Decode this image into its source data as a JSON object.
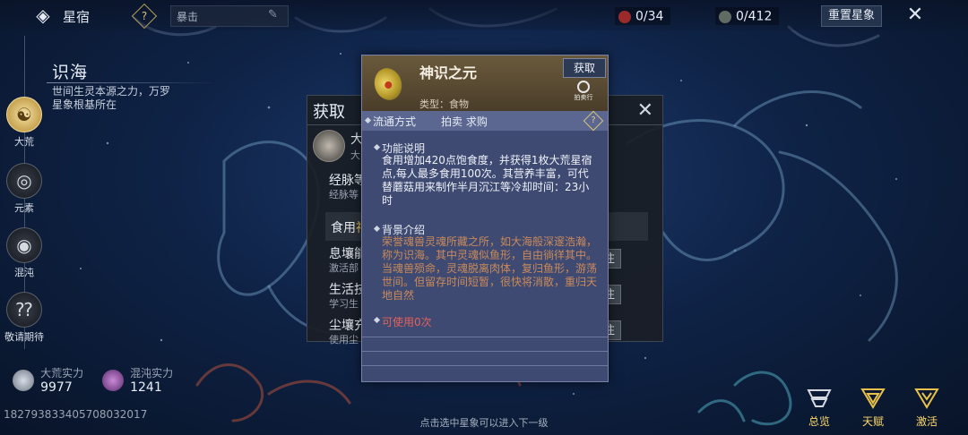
{
  "topbar": {
    "title": "星宿",
    "help_glyph": "?",
    "search_value": "暴击",
    "resource_red": "0/34",
    "resource_gray": "0/412",
    "reset_label": "重置星象",
    "close_glyph": "✕",
    "back_glyph": "◈"
  },
  "left": {
    "section_title": "识海",
    "section_desc": "世间生灵本源之力，万罗星象根基所在",
    "nav": [
      {
        "label": "大荒",
        "icon": "swirl-gold-icon",
        "glyph": "☯"
      },
      {
        "label": "元素",
        "icon": "spiral-icon",
        "glyph": "◎"
      },
      {
        "label": "混沌",
        "icon": "chaos-icon",
        "glyph": "◉"
      },
      {
        "label": "敬请期待",
        "icon": "question-icon",
        "glyph": "⁇"
      }
    ],
    "power": [
      {
        "label": "大荒实力",
        "value": "9977"
      },
      {
        "label": "混沌实力",
        "value": "1241"
      }
    ],
    "uid": "182793833405708032017"
  },
  "bottom": {
    "hint": "点击选中星象可以进入下一级",
    "buttons": [
      {
        "label": "总览",
        "icon": "overview-icon"
      },
      {
        "label": "天赋",
        "icon": "talent-icon"
      },
      {
        "label": "激活",
        "icon": "activate-icon"
      }
    ]
  },
  "dialog": {
    "title": "获取",
    "close_glyph": "✕",
    "item_name_partial": "大",
    "item_sub_partial": "大",
    "rows": [
      {
        "title": "经脉等",
        "sub": "经脉等",
        "go": ""
      },
      {
        "title": "息壤能",
        "sub": "激活部",
        "go": "前往"
      },
      {
        "title": "生活技",
        "sub": "学习生",
        "go": "前往"
      },
      {
        "title": "尘壤充",
        "sub": "使用尘",
        "go": "前往"
      }
    ],
    "food_label": "食用",
    "food_highlight": "神"
  },
  "tooltip": {
    "name": "神识之元",
    "type": "类型：食物",
    "get_label": "获取",
    "auction_label": "拍卖行",
    "flow_key": "流通方式",
    "flow_value": "拍卖  求购",
    "flow_help": "?",
    "func_title": "功能说明",
    "func_body": "食用增加420点饱食度，并获得1枚大荒星宿点,每人最多食用100次。其营养丰富，可代替蘑菇用来制作半月沉江等冷却时间：23小时",
    "bg_title": "背景介绍",
    "bg_body": "荣誉魂兽灵魂所藏之所，如大海般深邃浩瀚，称为识海。其中灵魂似鱼形，自由徜徉其中。当魂兽殒命，灵魂脱离肉体，复归鱼形，游荡世间。但留存时间短暂，很快将消散，重归天地自然",
    "usable": "可使用0次"
  },
  "colors": {
    "accent_gold": "#ffd96a",
    "usable_red": "#e0625b",
    "background_text": "#c98a5a"
  }
}
